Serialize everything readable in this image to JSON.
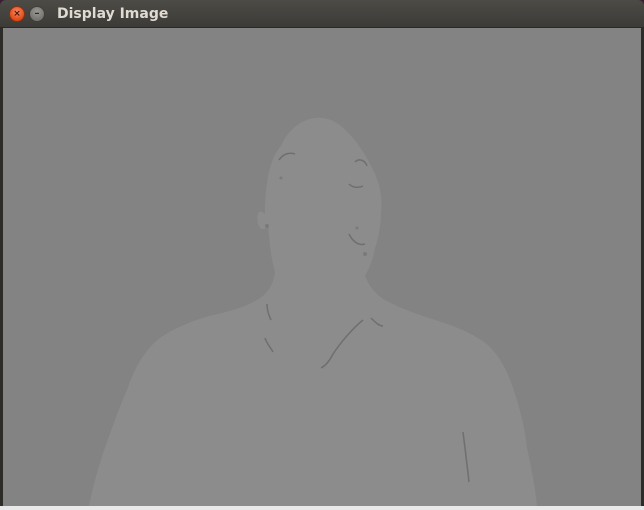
{
  "window": {
    "title": "Display Image",
    "buttons": {
      "close_glyph": "×",
      "minimize_glyph": "–"
    }
  },
  "image": {
    "description_icon": "depth-map-image",
    "background_color": "#838383",
    "silhouette_color": "#8c8c8c",
    "edge_color": "#6f6f6f"
  }
}
